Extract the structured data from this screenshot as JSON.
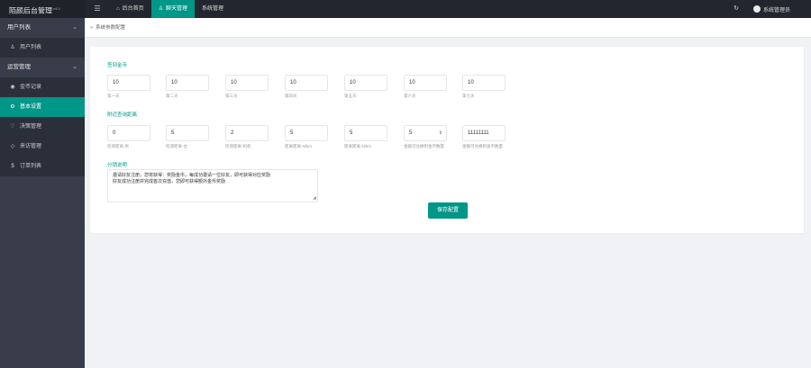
{
  "header": {
    "brand": "陌颜后台管理",
    "version": "v4.0",
    "menu_icon": "menu-icon",
    "nav": [
      {
        "label": "后台首页",
        "icon": "home-icon"
      },
      {
        "label": "聊天管理",
        "icon": "user-icon",
        "active": true
      },
      {
        "label": "系统管理"
      }
    ],
    "admin_label": "系统管理员"
  },
  "sidebar": {
    "groups": [
      {
        "label": "用户列表",
        "items": [
          {
            "label": "用户列表",
            "icon": "user-icon"
          }
        ]
      },
      {
        "label": "运营管理",
        "items": [
          {
            "label": "金币记录",
            "icon": "coin-icon"
          },
          {
            "label": "基本设置",
            "icon": "gear-icon",
            "active": true
          },
          {
            "label": "决策管理",
            "icon": "heart-icon"
          },
          {
            "label": "来访管理",
            "icon": "diamond-icon"
          },
          {
            "label": "订单列表",
            "icon": "dollar-icon"
          }
        ]
      }
    ]
  },
  "breadcrumb": {
    "separator": "»",
    "label": "系统参数配置"
  },
  "form": {
    "section1_title": "签到金币",
    "checkin": [
      {
        "value": "10",
        "label": "第一天"
      },
      {
        "value": "10",
        "label": "第二天"
      },
      {
        "value": "10",
        "label": "第三天"
      },
      {
        "value": "10",
        "label": "第四天"
      },
      {
        "value": "10",
        "label": "第五天"
      },
      {
        "value": "10",
        "label": "第六天"
      },
      {
        "value": "10",
        "label": "第七天"
      }
    ],
    "section2_title": "附近查询距离",
    "nearby": [
      {
        "value": "0",
        "label": "检测距离-男"
      },
      {
        "value": "5",
        "label": "检测距离-女"
      },
      {
        "value": "2",
        "label": "检测距离-机机"
      },
      {
        "value": "5",
        "label": "距离距离-N/km"
      },
      {
        "value": "5",
        "label": "距离距离-N/km"
      },
      {
        "value": "5",
        "label": "金额可兑换积金币数量",
        "spinner": true
      },
      {
        "value": "11111111",
        "label": "金额可兑换积金币数量"
      }
    ],
    "section3_title": "分销说明",
    "notice_lines": [
      "邀请好友注册，您将获得：奖励金币，每成功邀请一位好友，即可获得对应奖励",
      "好友成功注册并完成首次充值，您即可获得额外金币奖励"
    ],
    "save_label": "保存配置"
  }
}
